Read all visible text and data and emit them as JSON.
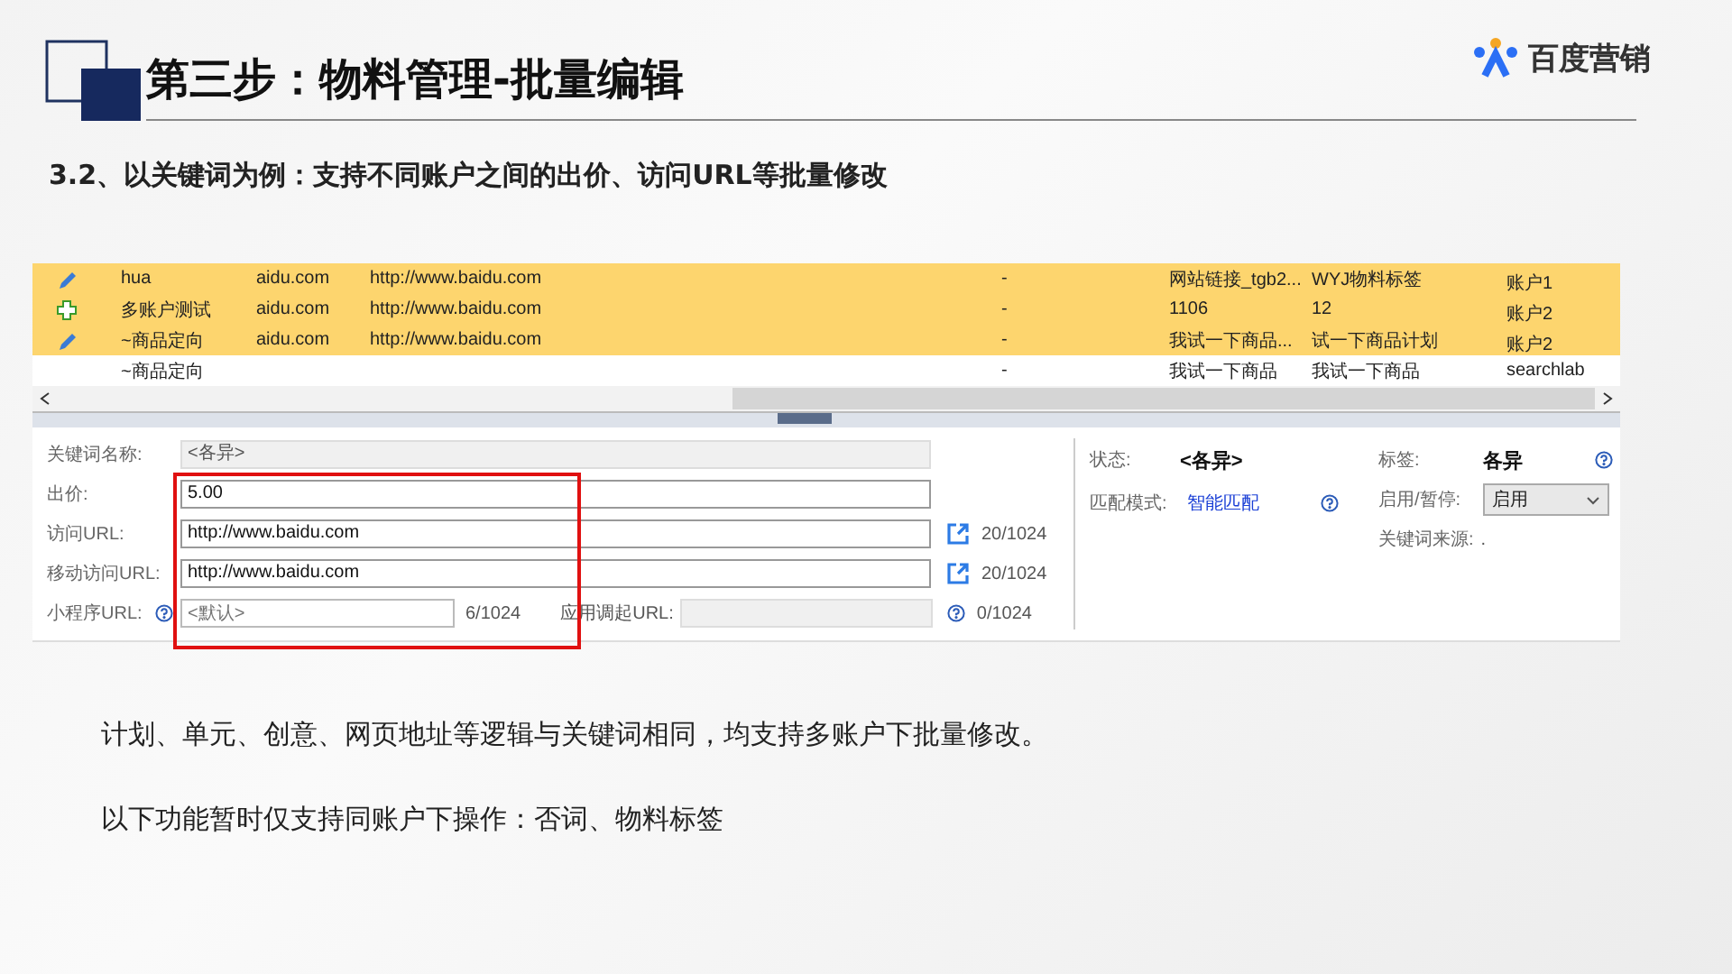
{
  "slide": {
    "title": "第三步：物料管理-批量编辑",
    "logo": "百度营销",
    "subtitle": "3.2、以关键词为例：支持不同账户之间的出价、访问URL等批量修改"
  },
  "table": {
    "rows": [
      {
        "kind": "edit",
        "selected": true,
        "cells": [
          "hua",
          "aidu.com",
          "http://www.baidu.com",
          "-",
          "网站链接_tgb2...",
          "WYJ物料标签",
          "账户1"
        ]
      },
      {
        "kind": "add",
        "selected": true,
        "cells": [
          "多账户测试",
          "aidu.com",
          "http://www.baidu.com",
          "-",
          "1106",
          "12",
          "账户2"
        ]
      },
      {
        "kind": "edit",
        "selected": true,
        "cells": [
          "~商品定向",
          "aidu.com",
          "http://www.baidu.com",
          "-",
          "我试一下商品...",
          "试一下商品计划",
          "账户2"
        ]
      },
      {
        "kind": "none",
        "selected": false,
        "cells": [
          "~商品定向",
          "",
          "",
          "-",
          "我试一下商品",
          "我试一下商品",
          "searchlab"
        ]
      }
    ]
  },
  "form": {
    "fields": [
      {
        "kind": "readonly",
        "label": "关键词名称:",
        "value": "<各异>"
      },
      {
        "kind": "input",
        "label": "出价:",
        "value": "5.00"
      },
      {
        "kind": "link",
        "label": "访问URL:",
        "value": "http://www.baidu.com",
        "counter": "20/1024"
      },
      {
        "kind": "link",
        "label": "移动访问URL:",
        "value": "http://www.baidu.com",
        "counter": "20/1024"
      }
    ],
    "mini": {
      "label": "小程序URL:",
      "placeholder": "<默认>",
      "counter": "6/1024",
      "app_label": "应用调起URL:",
      "app_counter": "0/1024"
    },
    "status": {
      "label": "状态:",
      "value": "<各异>"
    },
    "match": {
      "label": "匹配模式:",
      "value": "智能匹配"
    },
    "tag": {
      "label": "标签:",
      "value": "各异"
    },
    "enable": {
      "label": "启用/暂停:",
      "value": "启用"
    },
    "source": {
      "label": "关键词来源:",
      "value": "."
    }
  },
  "notes": [
    "计划、单元、创意、网页地址等逻辑与关键词相同，均支持多账户下批量修改。",
    "以下功能暂时仅支持同账户下操作：否词、物料标签"
  ]
}
